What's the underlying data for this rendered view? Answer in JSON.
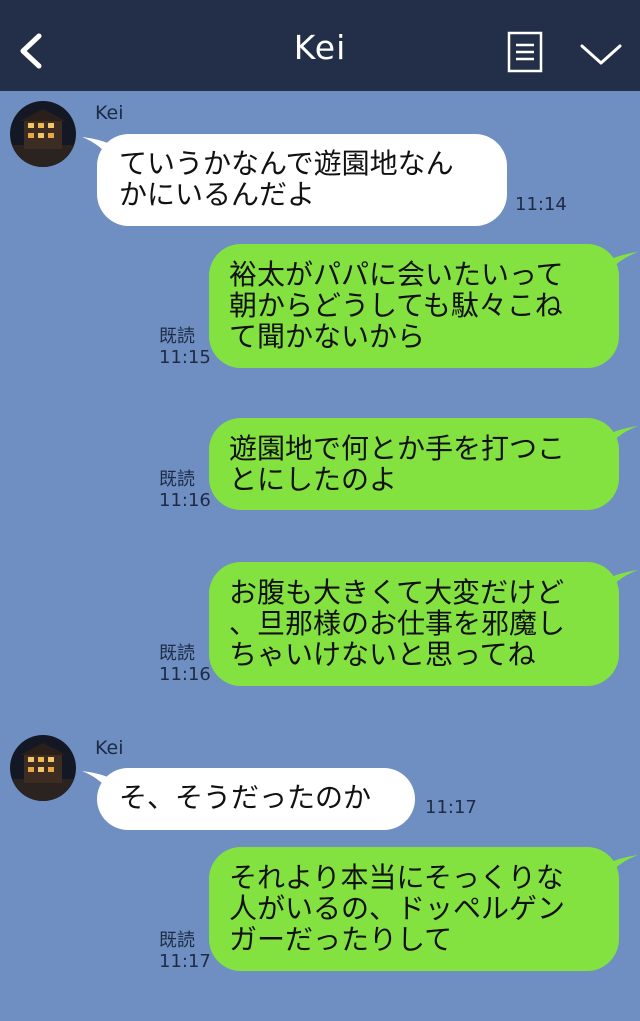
{
  "header": {
    "title": "Kei",
    "back_icon": "chevron-left-icon",
    "menu_icon": "document-list-icon",
    "more_icon": "chevron-down-icon",
    "color": "#232f48"
  },
  "colors": {
    "background": "#6f8fc2",
    "incoming": "#ffffff",
    "outgoing": "#84e240"
  },
  "messages": [
    {
      "side": "left",
      "sender": "Kei",
      "text": "ていうかなんで遊園地なん\nかにいるんだよ",
      "time": "11:14"
    },
    {
      "side": "right",
      "read": "既読",
      "text": "裕太がパパに会いたいって\n朝からどうしても駄々こね\nて聞かないから",
      "time": "11:15"
    },
    {
      "side": "right",
      "read": "既読",
      "text": "遊園地で何とか手を打つこ\nとにしたのよ",
      "time": "11:16"
    },
    {
      "side": "right",
      "read": "既読",
      "text": "お腹も大きくて大変だけど\n、旦那様のお仕事を邪魔し\nちゃいけないと思ってね",
      "time": "11:16"
    },
    {
      "side": "left",
      "sender": "Kei",
      "text": "そ、そうだったのか",
      "time": "11:17"
    },
    {
      "side": "right",
      "read": "既読",
      "text": "それより本当にそっくりな\n人がいるの、ドッペルゲン\nガーだったりして",
      "time": "11:17"
    }
  ]
}
